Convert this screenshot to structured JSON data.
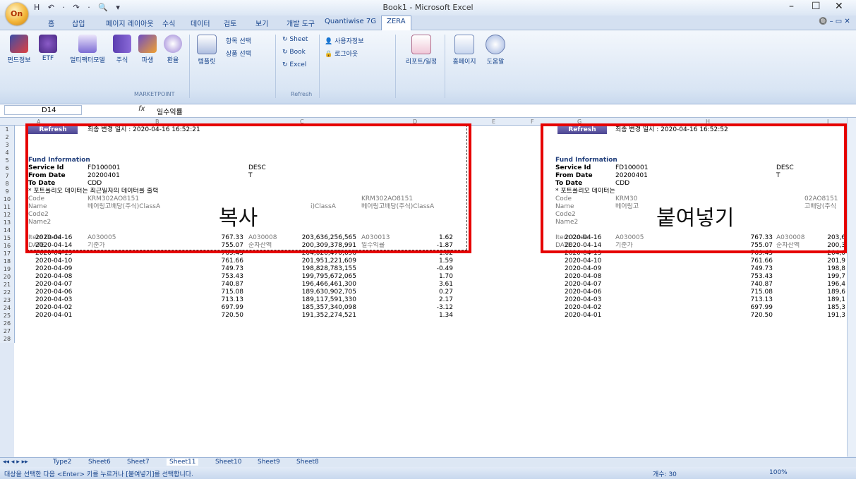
{
  "window": {
    "title": "Book1 - Microsoft Excel",
    "office_button": "On",
    "qat": "H ↶ · ↷ · 🔍 ▾",
    "minimize": "–",
    "maximize": "☐",
    "close": "✕",
    "help_controls": "🔘 – ▭ ✕"
  },
  "tabs": [
    "홈",
    "삽입",
    "페이지 레이아웃",
    "수식",
    "데이터",
    "검토",
    "보기",
    "개발 도구",
    "Quantiwise 7G",
    "ZERA"
  ],
  "ribbon": {
    "buttons": [
      "펀드정보",
      "ETF",
      "멀티팩터모델",
      "주식",
      "파생",
      "환율",
      "템플릿"
    ],
    "marketpoint_label": "MARKETPOINT",
    "item_select": "항목 선택",
    "product_select": "상품 선택",
    "sheet": "Sheet",
    "book": "Book",
    "excel": "Excel",
    "refresh_label": "Refresh",
    "user_info": "사용자정보",
    "logout": "로그아웃",
    "report": "리포트/일정",
    "homepage": "홈페이지",
    "help": "도움말"
  },
  "formula_bar": {
    "name_box": "D14",
    "fx": "fx",
    "value": "일수익률"
  },
  "columns": [
    "A",
    "B",
    "C",
    "D",
    "E",
    "F",
    "G",
    "H",
    "I"
  ],
  "rows": [
    "1",
    "2",
    "3",
    "4",
    "5",
    "6",
    "7",
    "8",
    "9",
    "10",
    "11",
    "12",
    "13",
    "14",
    "15",
    "16",
    "17",
    "18",
    "19",
    "20",
    "21",
    "22",
    "23",
    "24",
    "25",
    "26",
    "27",
    "28"
  ],
  "left": {
    "refresh": "Refresh",
    "updated": "최종 변경 일시 : 2020-04-16 16:52:21",
    "fund_info": "Fund Information",
    "service_id_label": "Service Id",
    "service_id": "FD100001",
    "desc": "DESC",
    "from_date_label": "From Date",
    "from_date": "20200401",
    "t": "T",
    "to_date_label": "To Date",
    "to_date": "CDD",
    "note": "* 포트폴리오 데이터는 최근일자의 데이터를 출력",
    "code_label": "Code",
    "code_b": "KRM302AO8151",
    "code_d": "KRM302AO8151",
    "name_label": "Name",
    "name_b": "베어링고배당(주식)ClassA",
    "name_c": "i)ClassA",
    "name_d": "베어링고배당(주식)ClassA",
    "code2_label": "Code2",
    "name2_label": "Name2",
    "item_code_label": "Item Code",
    "item_b": "A030005",
    "item_c": "A030008",
    "item_d": "A030013",
    "date_label": "DATE",
    "col_b": "기준가",
    "col_c": "순자산액",
    "col_d": "일수익률"
  },
  "right": {
    "refresh": "Refresh",
    "updated": "최종 변경 일시 : 2020-04-16 16:52:52",
    "fund_info": "Fund Information",
    "service_id_label": "Service Id",
    "service_id": "FD100001",
    "desc": "DESC",
    "from_date_label": "From Date",
    "from_date": "20200401",
    "t": "T",
    "to_date_label": "To Date",
    "to_date": "CDD",
    "note": "* 포트폴리오 데이터는",
    "code_label": "Code",
    "code_h": "KRM30",
    "code_i": "02AO8151",
    "name_label": "Name",
    "name_h": "베어링고",
    "name_i": "고배당(주식",
    "code2_label": "Code2",
    "name2_label": "Name2",
    "item_code_label": "Item Code",
    "item_h": "A030005",
    "item_i": "A030008",
    "date_label": "DATE",
    "col_h": "기준가",
    "col_i": "순자산액"
  },
  "overlay": {
    "copy": "복사",
    "paste": "붙여넣기"
  },
  "data_rows": [
    {
      "date": "2020-04-16",
      "nav": "767.33",
      "assets": "203,636,256,565",
      "ret": "1.62"
    },
    {
      "date": "2020-04-14",
      "nav": "755.07",
      "assets": "200,309,378,991",
      "ret": "-1.87"
    },
    {
      "date": "2020-04-13",
      "nav": "769.43",
      "assets": "204,020,470,696",
      "ret": "1.02"
    },
    {
      "date": "2020-04-10",
      "nav": "761.66",
      "assets": "201,951,221,609",
      "ret": "1.59"
    },
    {
      "date": "2020-04-09",
      "nav": "749.73",
      "assets": "198,828,783,155",
      "ret": "-0.49"
    },
    {
      "date": "2020-04-08",
      "nav": "753.43",
      "assets": "199,795,672,065",
      "ret": "1.70"
    },
    {
      "date": "2020-04-07",
      "nav": "740.87",
      "assets": "196,466,461,300",
      "ret": "3.61"
    },
    {
      "date": "2020-04-06",
      "nav": "715.08",
      "assets": "189,630,902,705",
      "ret": "0.27"
    },
    {
      "date": "2020-04-03",
      "nav": "713.13",
      "assets": "189,117,591,330",
      "ret": "2.17"
    },
    {
      "date": "2020-04-02",
      "nav": "697.99",
      "assets": "185,357,340,098",
      "ret": "-3.12"
    },
    {
      "date": "2020-04-01",
      "nav": "720.50",
      "assets": "191,352,274,521",
      "ret": "1.34"
    }
  ],
  "right_data_rows": [
    {
      "date": "2020-04-16",
      "nav": "767.33",
      "assets": "203,6"
    },
    {
      "date": "2020-04-14",
      "nav": "755.07",
      "assets": "200,3"
    },
    {
      "date": "2020-04-13",
      "nav": "769.43",
      "assets": "204,0"
    },
    {
      "date": "2020-04-10",
      "nav": "761.66",
      "assets": "201,9"
    },
    {
      "date": "2020-04-09",
      "nav": "749.73",
      "assets": "198,8"
    },
    {
      "date": "2020-04-08",
      "nav": "753.43",
      "assets": "199,7"
    },
    {
      "date": "2020-04-07",
      "nav": "740.87",
      "assets": "196,4"
    },
    {
      "date": "2020-04-06",
      "nav": "715.08",
      "assets": "189,6"
    },
    {
      "date": "2020-04-03",
      "nav": "713.13",
      "assets": "189,1"
    },
    {
      "date": "2020-04-02",
      "nav": "697.99",
      "assets": "185,3"
    },
    {
      "date": "2020-04-01",
      "nav": "720.50",
      "assets": "191,3"
    }
  ],
  "sheet_nav": "◂◂ ◂ ▸ ▸▸",
  "sheets": [
    "Type2",
    "Sheet6",
    "Sheet7",
    "Sheet11",
    "Sheet10",
    "Sheet9",
    "Sheet8"
  ],
  "active_sheet": "Sheet11",
  "status": {
    "message": "대상을 선택한 다음 <Enter> 키를 누르거나 [붙여넣기]를 선택합니다.",
    "count": "개수: 30",
    "zoom": "100%"
  }
}
